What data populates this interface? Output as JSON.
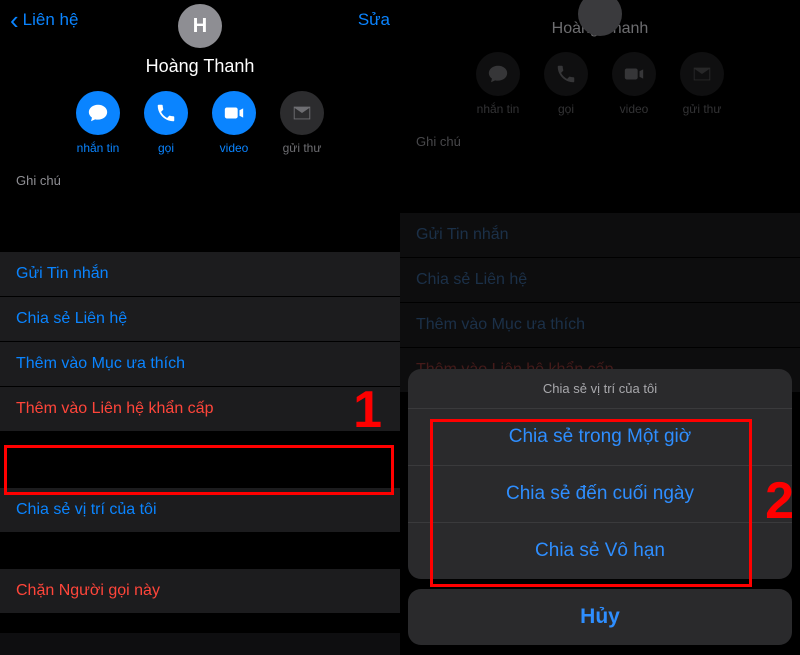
{
  "left": {
    "back_label": "Liên hệ",
    "edit_label": "Sửa",
    "avatar_initial": "H",
    "contact_name": "Hoàng Thanh",
    "actions": {
      "message": "nhắn tin",
      "call": "gọi",
      "video": "video",
      "mail": "gửi thư"
    },
    "notes_header": "Ghi chú",
    "row_send_message": "Gửi Tin nhắn",
    "row_share_contact": "Chia sẻ Liên hệ",
    "row_add_favorite": "Thêm vào Mục ưa thích",
    "row_add_emergency": "Thêm vào Liên hệ khẩn cấp",
    "row_share_location": "Chia sẻ vị trí của tôi",
    "row_block_caller": "Chặn Người gọi này",
    "marker": "1"
  },
  "right": {
    "contact_name": "Hoàng Thanh",
    "actions": {
      "message": "nhắn tin",
      "call": "gọi",
      "video": "video",
      "mail": "gửi thư"
    },
    "notes_header": "Ghi chú",
    "row_send_message": "Gửi Tin nhắn",
    "row_share_contact": "Chia sẻ Liên hệ",
    "row_add_favorite": "Thêm vào Mục ưa thích",
    "row_add_emergency": "Thêm vào Liên hệ khẩn cấp",
    "sheet": {
      "title": "Chia sẻ vị trí của tôi",
      "opt_one_hour": "Chia sẻ trong Một giờ",
      "opt_end_of_day": "Chia sẻ đến cuối ngày",
      "opt_indefinitely": "Chia sẻ Vô hạn",
      "cancel": "Hủy"
    },
    "marker": "2"
  },
  "colors": {
    "ios_blue": "#0a84ff",
    "ios_red": "#ff453a",
    "annotation_red": "#ff0000"
  }
}
